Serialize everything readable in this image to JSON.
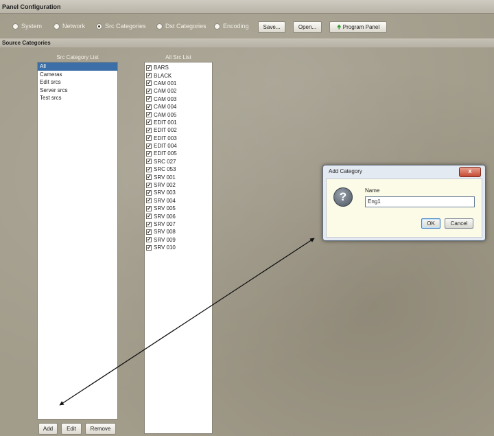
{
  "app": {
    "title": "Panel Configuration"
  },
  "tabs": [
    {
      "label": "System",
      "selected": false
    },
    {
      "label": "Network",
      "selected": false
    },
    {
      "label": "Src Categories",
      "selected": true
    },
    {
      "label": "Dst Categories",
      "selected": false
    },
    {
      "label": "Encoding",
      "selected": false
    }
  ],
  "toolbar": {
    "save_label": "Save...",
    "open_label": "Open...",
    "program_label": "Program Panel"
  },
  "section": {
    "label": "Source Categories"
  },
  "category_list": {
    "header": "Src Category List",
    "items": [
      "All",
      "Cameras",
      "Edit srcs",
      "Server srcs",
      "Test srcs"
    ],
    "selected": "All",
    "add_label": "Add",
    "edit_label": "Edit",
    "remove_label": "Remove"
  },
  "src_list": {
    "header": "All Src List",
    "items": [
      "BARS",
      "BLACK",
      "CAM 001",
      "CAM 002",
      "CAM 003",
      "CAM 004",
      "CAM 005",
      "EDIT 001",
      "EDIT 002",
      "EDIT 003",
      "EDIT 004",
      "EDIT 005",
      "SRC 027",
      "SRC 053",
      "SRV 001",
      "SRV 002",
      "SRV 003",
      "SRV 004",
      "SRV 005",
      "SRV 006",
      "SRV 007",
      "SRV 008",
      "SRV 009",
      "SRV 010"
    ],
    "checked": true
  },
  "dialog": {
    "title": "Add Category",
    "close_label": "x",
    "field_label": "Name",
    "field_value": "Eng1",
    "ok_label": "OK",
    "cancel_label": "Cancel"
  },
  "colors": {
    "selection": "#3c6fa7",
    "background": "#a29c8b",
    "program_icon": "#2e9a2e"
  },
  "icons": {
    "question": "question-icon",
    "program": "green-up-arrow-icon",
    "checkbox": "checkmark-icon"
  }
}
